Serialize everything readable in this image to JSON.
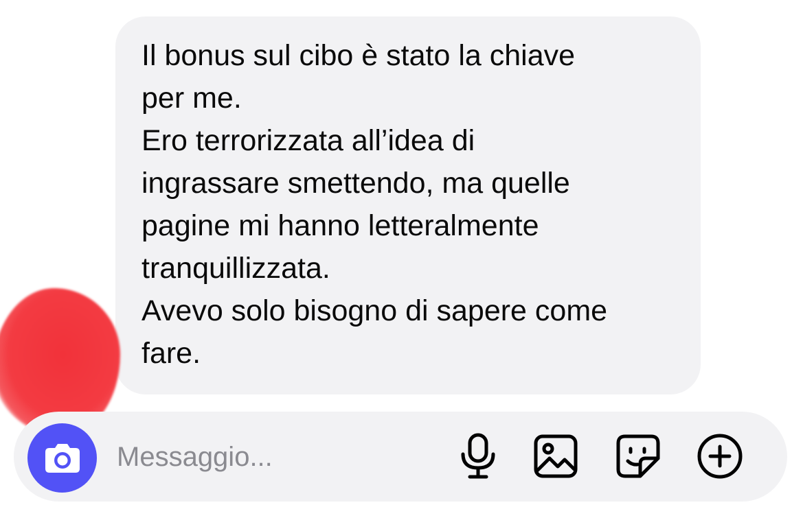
{
  "message": {
    "paragraphs": [
      "Il bonus sul cibo è stato la chiave\nper me.",
      "Ero terrorizzata all’idea di\ningrassare smettendo, ma quelle\npagine mi hanno letteralmente\ntranquillizzata.",
      "Avevo solo bisogno di sapere come\nfare."
    ]
  },
  "composer": {
    "placeholder": "Messaggio...",
    "camera_icon": "camera-icon",
    "tools": [
      "microphone-icon",
      "image-icon",
      "sticker-icon",
      "plus-circle-icon"
    ]
  },
  "colors": {
    "bubble_bg": "#f2f2f4",
    "camera_button": "#5252f6",
    "redaction": "#f33b42",
    "placeholder_text": "#8a8a90",
    "icon_stroke": "#000000"
  }
}
